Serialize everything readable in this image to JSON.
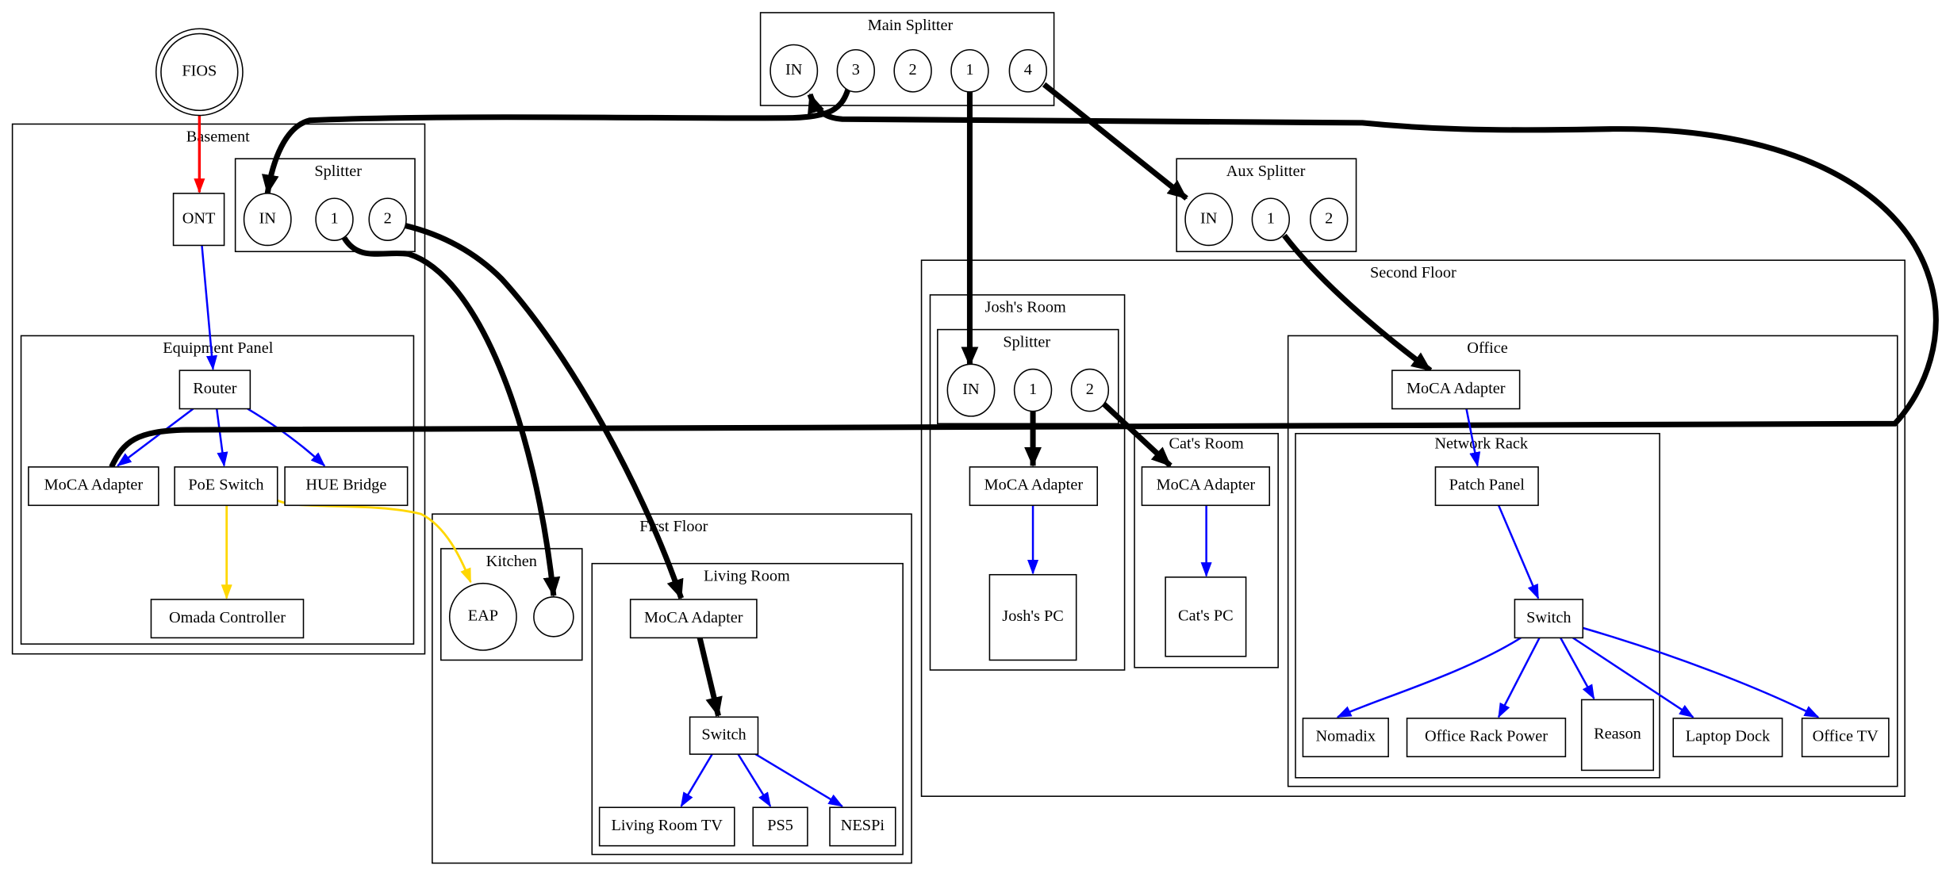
{
  "colors": {
    "fiber": "#ff0000",
    "ethernet": "#0000ff",
    "poe": "#ffd700",
    "coax": "#000000"
  },
  "fios": {
    "label": "FIOS"
  },
  "main_splitter": {
    "label": "Main Splitter",
    "ports": [
      "IN",
      "3",
      "2",
      "1",
      "4"
    ]
  },
  "aux_splitter": {
    "label": "Aux Splitter",
    "ports": [
      "IN",
      "1",
      "2"
    ]
  },
  "basement": {
    "label": "Basement",
    "ont": "ONT",
    "splitter": {
      "label": "Splitter",
      "ports": [
        "IN",
        "1",
        "2"
      ]
    },
    "equipment_panel": {
      "label": "Equipment Panel",
      "router": "Router",
      "moca": "MoCA Adapter",
      "poe_switch": "PoE Switch",
      "hue_bridge": "HUE Bridge",
      "omada": "Omada Controller"
    }
  },
  "first_floor": {
    "label": "First Floor",
    "kitchen": {
      "label": "Kitchen",
      "eap": "EAP"
    },
    "living_room": {
      "label": "Living Room",
      "moca": "MoCA Adapter",
      "switch": "Switch",
      "devices": [
        "Living Room TV",
        "PS5",
        "NESPi"
      ]
    }
  },
  "second_floor": {
    "label": "Second Floor",
    "joshs_room": {
      "label": "Josh's Room",
      "splitter": {
        "label": "Splitter",
        "ports": [
          "IN",
          "1",
          "2"
        ]
      },
      "moca": "MoCA Adapter",
      "pc": "Josh's PC"
    },
    "cats_room": {
      "label": "Cat's Room",
      "moca": "MoCA Adapter",
      "pc": "Cat's PC"
    },
    "office": {
      "label": "Office",
      "moca": "MoCA Adapter",
      "network_rack": {
        "label": "Network Rack",
        "patch_panel": "Patch Panel",
        "switch": "Switch",
        "devices": [
          "Nomadix",
          "Office Rack Power",
          "Reason"
        ]
      },
      "devices": [
        "Laptop Dock",
        "Office TV"
      ]
    }
  }
}
